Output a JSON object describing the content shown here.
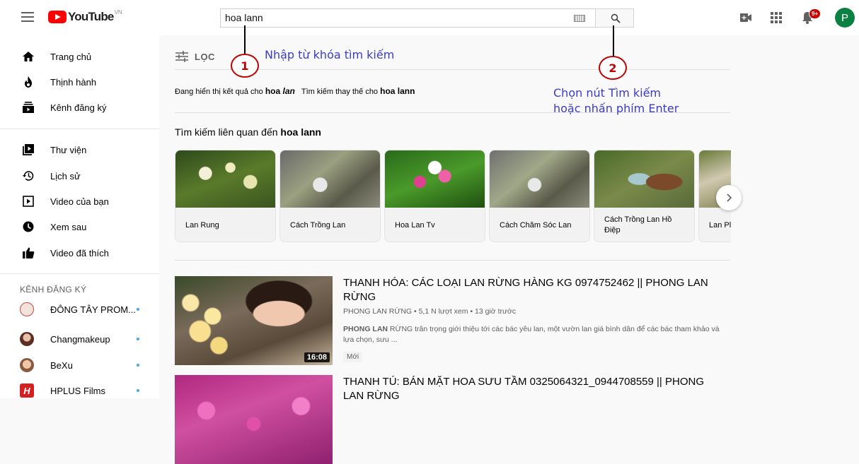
{
  "masthead": {
    "logo_text": "YouTube",
    "region": "VN",
    "search_value": "hoa lann",
    "notification_badge": "9+",
    "avatar_letter": "P"
  },
  "sidebar": {
    "items": [
      {
        "label": "Trang chủ",
        "icon": "home-icon"
      },
      {
        "label": "Thịnh hành",
        "icon": "fire-icon"
      },
      {
        "label": "Kênh đăng ký",
        "icon": "subscriptions-icon"
      },
      {
        "label": "Thư viện",
        "icon": "library-icon"
      },
      {
        "label": "Lịch sử",
        "icon": "history-icon"
      },
      {
        "label": "Video của bạn",
        "icon": "your-videos-icon"
      },
      {
        "label": "Xem sau",
        "icon": "watch-later-icon"
      },
      {
        "label": "Video đã thích",
        "icon": "like-icon"
      }
    ],
    "subscriptions_title": "KÊNH ĐĂNG KÝ",
    "subscriptions": [
      {
        "name": "ĐÔNG TÂY PROM...",
        "color": "#e8d0c0"
      },
      {
        "name": "Changmakeup",
        "color": "#7a4a3a"
      },
      {
        "name": "BeXu",
        "color": "#c08060"
      },
      {
        "name": "HPLUS Films",
        "color": "#d42020"
      }
    ]
  },
  "main": {
    "filter_label": "LỌC",
    "correction": {
      "prefix": "Đang hiển thị kết quả cho",
      "shown": "hoa",
      "shown_italic": "lan",
      "alt_prefix": "Tìm kiếm thay thế cho",
      "alt_query": "hoa lann"
    },
    "related": {
      "prefix": "Tìm kiếm liên quan đến",
      "query": "hoa lann",
      "chips": [
        {
          "label": "Lan Rung"
        },
        {
          "label": "Cách Trồng Lan"
        },
        {
          "label": "Hoa Lan Tv"
        },
        {
          "label": "Cách Chăm Sóc Lan"
        },
        {
          "label": "Cách Trồng Lan Hồ Điệp"
        },
        {
          "label": "Lan Pl"
        }
      ]
    },
    "videos": [
      {
        "title": "THANH HÓA: CÁC LOẠI LAN RỪNG HÀNG KG 0974752462 || PHONG LAN RỪNG",
        "meta": "PHONG LAN RỪNG • 5,1 N lượt xem • 13 giờ trước",
        "desc_bold": "PHONG LAN",
        "desc": " RỪNG trân trọng giới thiệu tới các bác yêu lan, một vườn lan giá bình dân để các bác tham khảo và lựa chọn, sưu ...",
        "duration": "16:08",
        "badge": "Mới"
      },
      {
        "title": "THANH TÚ: BÁN MẶT HOA SƯU TẦM 0325064321_0944708559 || PHONG LAN RỪNG"
      }
    ]
  },
  "annotations": {
    "step1_num": "1",
    "step1_text": "Nhập từ khóa tìm kiếm",
    "step2_num": "2",
    "step2_line1": "Chọn nút Tìm kiếm",
    "step2_line2": "hoặc nhấn phím Enter"
  }
}
